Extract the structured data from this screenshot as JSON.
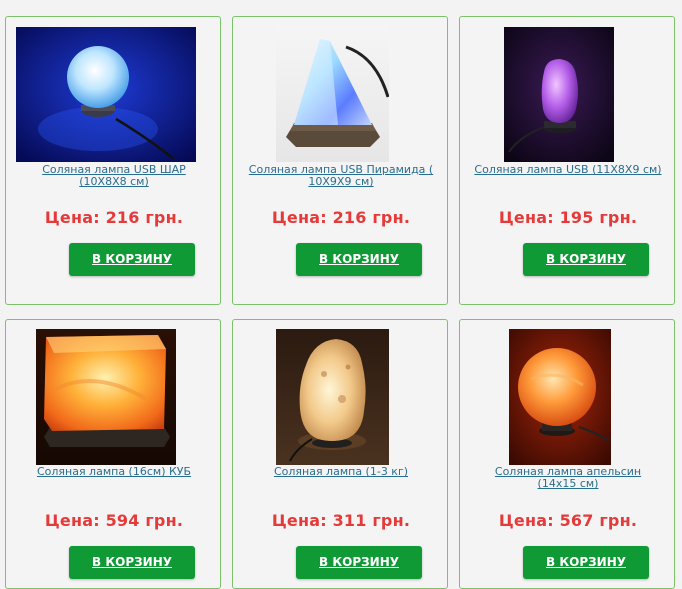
{
  "products": [
    {
      "title": "Соляная лампа USB ШАР (10Х8Х8 см)",
      "price": "Цена: 216 грн.",
      "button": "В КОРЗИНУ",
      "image": "blue-glowing-salt-lamp-sphere"
    },
    {
      "title": "Соляная лампа USB Пирамида ( 10Х9Х9 см)",
      "price": "Цена: 216 грн.",
      "button": "В КОРЗИНУ",
      "image": "blue-glowing-salt-lamp-pyramid"
    },
    {
      "title": "Соляная лампа USB (11Х8Х9 см)",
      "price": "Цена: 195 грн.",
      "button": "В КОРЗИНУ",
      "image": "purple-glowing-salt-lamp"
    },
    {
      "title": "Соляная лампа (16см) КУБ",
      "price": "Цена: 594 грн.",
      "button": "В КОРЗИНУ",
      "image": "orange-salt-lamp-cube"
    },
    {
      "title": "Соляная лампа (1-3 кг)",
      "price": "Цена: 311 грн.",
      "button": "В КОРЗИНУ",
      "image": "natural-salt-lamp-rock"
    },
    {
      "title": "Соляная лампа апельсин (14х15 см)",
      "price": "Цена: 567 грн.",
      "button": "В КОРЗИНУ",
      "image": "orange-salt-lamp-sphere"
    }
  ],
  "colors": {
    "card_border": "#7dc16a",
    "price": "#e53a3a",
    "button_bg": "#0f9a35",
    "link": "#2a6e8e"
  }
}
